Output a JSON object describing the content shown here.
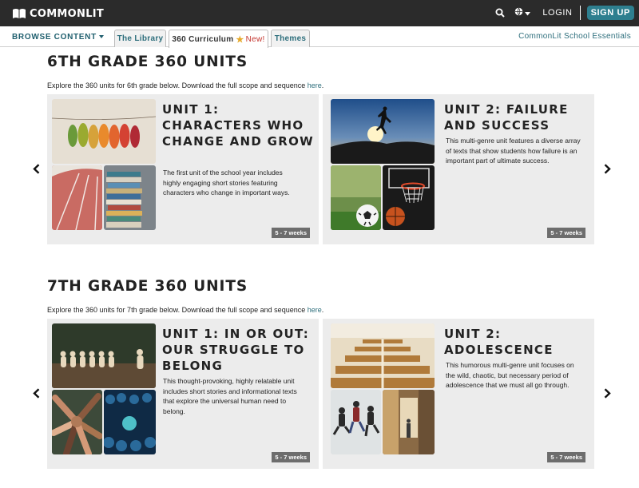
{
  "header": {
    "logo_text": "COMMONLIT",
    "login_label": "LOGIN",
    "signup_label": "SIGN UP",
    "icons": [
      "book-logo-icon",
      "search-icon",
      "globe-icon",
      "caret-down-icon"
    ]
  },
  "nav": {
    "browse_label": "BROWSE CONTENT",
    "tabs": [
      {
        "label": "The Library"
      },
      {
        "label": "360 Curriculum",
        "badge": "New!"
      },
      {
        "label": "Themes"
      }
    ],
    "essentials_label": "CommonLit School Essentials"
  },
  "colors": {
    "topbar": "#2b2b2b",
    "accent": "#2e7f8f",
    "link": "#2d6e7c",
    "card_bg": "#ececec",
    "new_badge": "#c4362f",
    "star": "#e6a92a"
  },
  "sections": [
    {
      "title": "6TH GRADE 360 UNITS",
      "desc": "Explore the 360 units for 6th grade below. Download the full scope and sequence ",
      "link": "here",
      "period": ".",
      "units": [
        {
          "title": "UNIT 1: CHARACTERS WHO CHANGE AND GROW",
          "desc": "The first unit of the school year includes highly engaging short stories featuring characters who change in important ways.",
          "weeks": "5 - 7 weeks"
        },
        {
          "title": "UNIT 2: FAILURE AND SUCCESS",
          "desc": "This multi-genre unit features a diverse array of texts that show students how failure is an important part of ultimate success.",
          "weeks": "5 - 7 weeks"
        }
      ]
    },
    {
      "title": "7TH GRADE 360 UNITS",
      "desc": "Explore the 360 units for 7th grade below. Download the full scope and sequence ",
      "link": "here",
      "period": ".",
      "units": [
        {
          "title": "UNIT 1: IN OR OUT: OUR STRUGGLE TO BELONG",
          "desc": "This thought-provoking, highly relatable unit includes short stories and informational texts that explore the universal human need to belong.",
          "weeks": "5 - 7 weeks"
        },
        {
          "title": "UNIT 2: ADOLESCENCE",
          "desc": "This humorous multi-genre unit focuses on the wild, chaotic, but necessary period of adolescence that we must all go through.",
          "weeks": "5 - 7 weeks"
        }
      ]
    }
  ]
}
